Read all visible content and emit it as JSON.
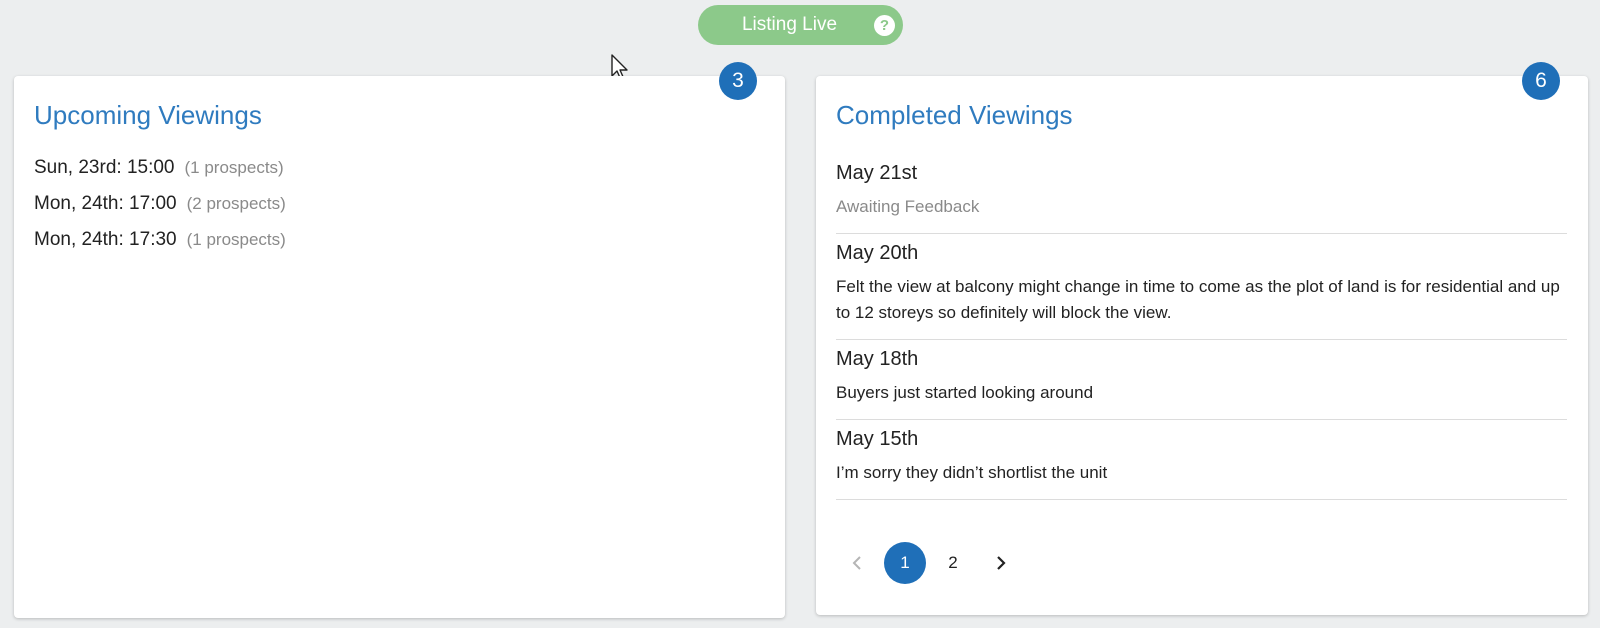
{
  "status": {
    "label": "Listing Live",
    "help_glyph": "?",
    "color": "#8cc98a"
  },
  "upcoming": {
    "title": "Upcoming Viewings",
    "count": "3",
    "items": [
      {
        "time": "Sun, 23rd: 15:00",
        "prospects": "(1 prospects)"
      },
      {
        "time": "Mon, 24th: 17:00",
        "prospects": "(2 prospects)"
      },
      {
        "time": "Mon, 24th: 17:30",
        "prospects": "(1 prospects)"
      }
    ]
  },
  "completed": {
    "title": "Completed Viewings",
    "count": "6",
    "items": [
      {
        "date": "May 21st",
        "note": "Awaiting Feedback"
      },
      {
        "date": "May 20th",
        "note": "Felt the view at balcony might change in time to come as the plot of land is for residential and up to 12 storeys so definitely will block the view."
      },
      {
        "date": "May 18th",
        "note": "Buyers just started looking around"
      },
      {
        "date": "May 15th",
        "note": "I’m sorry they didn’t shortlist the unit"
      }
    ]
  },
  "pagination": {
    "pages": [
      "1",
      "2"
    ],
    "current_page": 1,
    "prev_icon": "chevron-left-icon",
    "next_icon": "chevron-right-icon"
  },
  "colors": {
    "accent": "#1f6fb8",
    "title": "#2f7bbf",
    "background": "#eceeef"
  }
}
